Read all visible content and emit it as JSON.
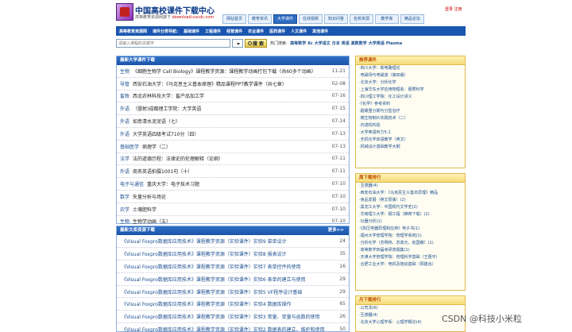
{
  "header": {
    "site_title": "中国高校课件下载中心",
    "site_sub": "高等教育资源网旗下",
    "site_url": "download.cucdc.com",
    "login_links": "登录 注册",
    "nav_tabs": [
      {
        "label": "网站首页",
        "active": false
      },
      {
        "label": "教育资讯",
        "active": false
      },
      {
        "label": "大学课件",
        "active": true
      },
      {
        "label": "在线视频",
        "active": false
      },
      {
        "label": "知识问答",
        "active": false
      },
      {
        "label": "名校资源",
        "active": false
      },
      {
        "label": "教学库",
        "active": false
      },
      {
        "label": "精品论坛",
        "active": false
      }
    ]
  },
  "category_bar": {
    "items": [
      "高等教育资源网",
      "课件分类导航:",
      "基础课件",
      "工程课件",
      "经管课件",
      "农业课件",
      "医药课件",
      "人文课件",
      "其他课件"
    ]
  },
  "search": {
    "placeholder": "请输入课程的关键字",
    "button_label": "搜 索",
    "hot_label": "热门搜索:",
    "hot_words": [
      "高等数学",
      "8c",
      "大学语文",
      "日本",
      "英语",
      "高数数学",
      "大学英语",
      "Plasma"
    ]
  },
  "latest": {
    "heading": "最新大学课件下载",
    "rows": [
      {
        "cat": "生物",
        "title": "《细胞生物学 Cell Biology》课程教学资源：课程教学动画打包下载（共60多个动画）",
        "date": "11-21"
      },
      {
        "cat": "导管",
        "title": "西安石油大学：《马克思主义基本原理》精品课程PPT教学课件（共七章）",
        "date": "02-08"
      },
      {
        "cat": "畜牧",
        "title": "西北农林科技大学：畜产品加工学",
        "date": "07-16"
      },
      {
        "cat": "外语",
        "title": "（暨射)成都理工学院：大学英语",
        "date": "07-15"
      },
      {
        "cat": "外语",
        "title": "如意清水泥泥语（七）",
        "date": "07-14"
      },
      {
        "cat": "外语",
        "title": "大学英语四级考试710分（四）",
        "date": "07-13"
      },
      {
        "cat": "基础医学",
        "title": "病理学（二）",
        "date": "07-13"
      },
      {
        "cat": "法学",
        "title": "法的道德历程：法律史的伦理解释（论纲）",
        "date": "07-11"
      },
      {
        "cat": "外语",
        "title": "商务英语拍摄1001句（十）",
        "date": "07-11"
      },
      {
        "cat": "电子与通信",
        "title": "重庆大学：电子技术习题",
        "date": "07-10"
      },
      {
        "cat": "数学",
        "title": "矢量分析与场论",
        "date": "07-10"
      },
      {
        "cat": "农学",
        "title": "土壤肥料学",
        "date": "07-10"
      },
      {
        "cat": "生物",
        "title": "生物学动画（五）",
        "date": "07-10"
      }
    ]
  },
  "library": {
    "heading": "最新文库资源下载",
    "more_label": "更多>>",
    "rows": [
      {
        "title": "《Visual Foxpro数据库应用技术》课程教学资源（实验课件）实验9 菜单设计",
        "count": "24"
      },
      {
        "title": "《Visual Foxpro数据库应用技术》课程教学资源（实验课件）实验8 报表设计",
        "count": "35"
      },
      {
        "title": "《Visual Foxpro数据库应用技术》课程教学资源（实验课件）实验7 表单控件的使用",
        "count": "16"
      },
      {
        "title": "《Visual Foxpro数据库应用技术》课程教学资源（实验课件）实验6 表单的建立与使用",
        "count": "29"
      },
      {
        "title": "《Visual Foxpro数据库应用技术》课程教学资源（实验课件）实验5 VF程序设计基础",
        "count": "29"
      },
      {
        "title": "《Visual Foxpro数据库应用技术》课程教学资源（实验课件）实验4 数据库操作",
        "count": "65"
      },
      {
        "title": "《Visual Foxpro数据库应用技术》课程教学资源（实验课件）实验3 常量、变量与函数的使用",
        "count": "26"
      },
      {
        "title": "《Visual Foxpro数据库应用技术》课程教学资源（实验课件）实验2 数据表的建立、维护和使用",
        "count": "50"
      }
    ]
  },
  "sidebar": {
    "recommend": {
      "heading": "推荐课件",
      "items": [
        "·四川大学：新电路理论",
        "·电磁场与电磁波（第四版）",
        "·北京大学：分析化学",
        "·上海华东大学应用物理系：硬质科学",
        "·四川理工学院：化工设计讲义",
        "·《化学》参考资料",
        "·超缓重分期与分型治疗",
        "·微生物制片实践技术（二）",
        "·内诺机构造",
        "·大学英语听力5-1",
        "·无机化学双语教学（英文）",
        "·机械设计基础教学大纲"
      ]
    },
    "weekly": {
      "heading": "周下载排行",
      "items": [
        "·互感器(4)",
        "·西安石油大学：《马克思主义基本原理》精品",
        "·食品发展（英文原版）(2)",
        "·黑龙江大学：中国现代文学史(2)",
        "·华南理工大学：钢工程（推荐下载）(2)",
        "·仪器分析(1)",
        "·《高压电器原理和应用》电子书(1)",
        "·福州大学管理学院：管理学系统(1)",
        "·分析化学（苏明玮、苏高元、赵国薇）(1)",
        "·高等数学四届考研真题集(1)",
        "·天津大学管理学院：管理科学基础（王晋平）",
        "·合肥工业大学：电机及拖动基础（阳建谷）"
      ]
    },
    "monthly": {
      "heading": "月下载排行",
      "items": [
        "·公司法(6)",
        "·互感器(4)",
        "·北京大学心理学系：心理学概论(4)"
      ]
    }
  },
  "watermark": "CSDN @科技小米粒"
}
